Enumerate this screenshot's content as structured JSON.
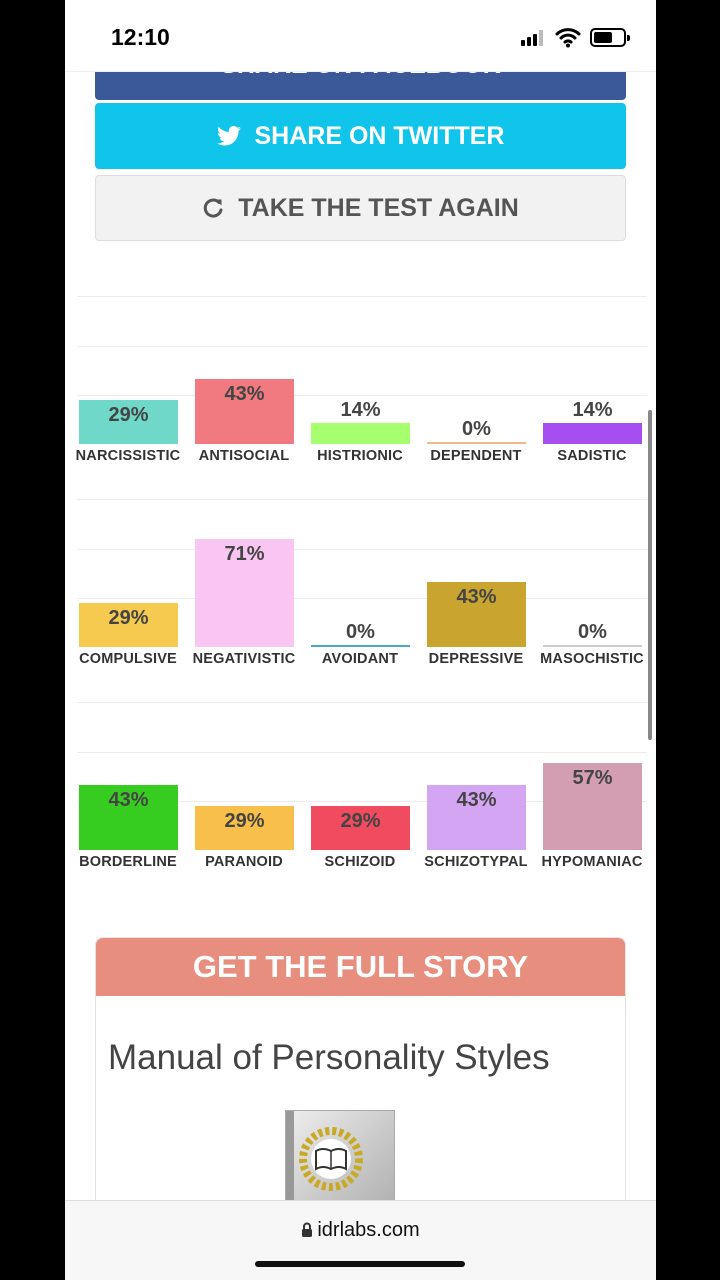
{
  "status_bar": {
    "time": "12:10"
  },
  "buttons": {
    "facebook_label": "SHARE ON FACEBOOK",
    "twitter_label": "SHARE ON TWITTER",
    "again_label": "TAKE THE TEST AGAIN"
  },
  "chart_data": {
    "type": "bar",
    "ylim": [
      0,
      100
    ],
    "rows": [
      {
        "categories": [
          "NARCISSISTIC",
          "ANTISOCIAL",
          "HISTRIONIC",
          "DEPENDENT",
          "SADISTIC"
        ],
        "values": [
          29,
          43,
          14,
          0,
          14
        ],
        "labels": [
          "29%",
          "43%",
          "14%",
          "0%",
          "14%"
        ],
        "colors": [
          "#6fd8c9",
          "#f07a80",
          "#a6ff6e",
          "#f2b98a",
          "#a54ff1"
        ]
      },
      {
        "categories": [
          "COMPULSIVE",
          "NEGATIVISTIC",
          "AVOIDANT",
          "DEPRESSIVE",
          "MASOCHISTIC"
        ],
        "values": [
          29,
          71,
          0,
          43,
          0
        ],
        "labels": [
          "29%",
          "71%",
          "0%",
          "43%",
          "0%"
        ],
        "colors": [
          "#f6c94f",
          "#f8c6f0",
          "#4aa8c9",
          "#c9a530",
          "#cccccc"
        ]
      },
      {
        "categories": [
          "BORDERLINE",
          "PARANOID",
          "SCHIZOID",
          "SCHIZOTYPAL",
          "HYPOMANIAC"
        ],
        "values": [
          43,
          29,
          29,
          43,
          57
        ],
        "labels": [
          "43%",
          "29%",
          "29%",
          "43%",
          "57%"
        ],
        "colors": [
          "#37cc20",
          "#f8c04a",
          "#f04b5e",
          "#d3a5f3",
          "#d39eb1"
        ]
      }
    ]
  },
  "story": {
    "header": "GET THE FULL STORY",
    "book_title": "Manual of Personality Styles"
  },
  "browser": {
    "url": "idrlabs.com"
  }
}
